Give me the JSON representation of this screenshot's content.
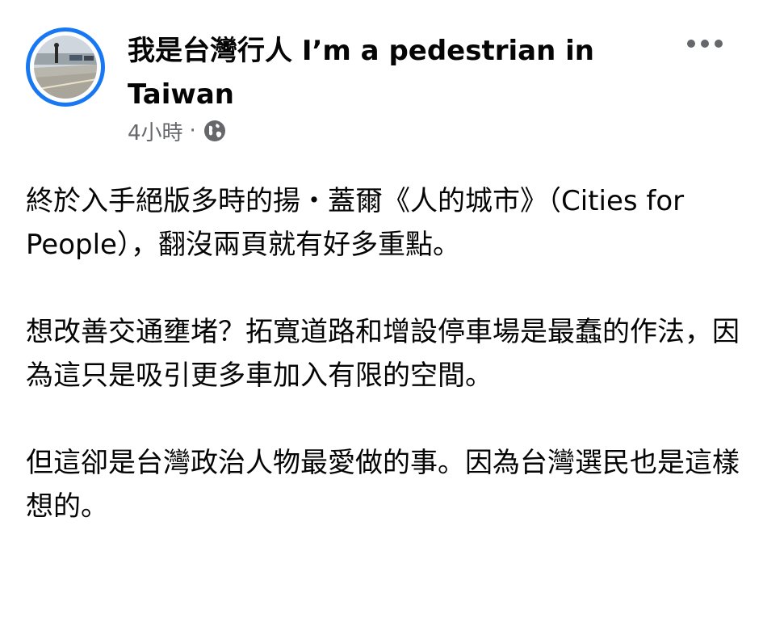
{
  "post": {
    "page_name": "我是台灣行人 I’m a pedestrian in Taiwan",
    "timestamp": "4小時",
    "separator": "·",
    "privacy_icon": "globe-icon",
    "more_icon": "more-horizontal-icon",
    "paragraphs": [
      "終於入手絕版多時的揚・蓋爾《人的城市》（Cities for People），翻沒兩頁就有好多重點。",
      "想改善交通壅堵？拓寬道路和增設停車場是最蠢的作法，因為這只是吸引更多車加入有限的空間。",
      "但這卻是台灣政治人物最愛做的事。因為台灣選民也是這樣想的。"
    ]
  },
  "colors": {
    "accent": "#1877f2",
    "meta_text": "#65676b",
    "body_text": "#050505"
  }
}
